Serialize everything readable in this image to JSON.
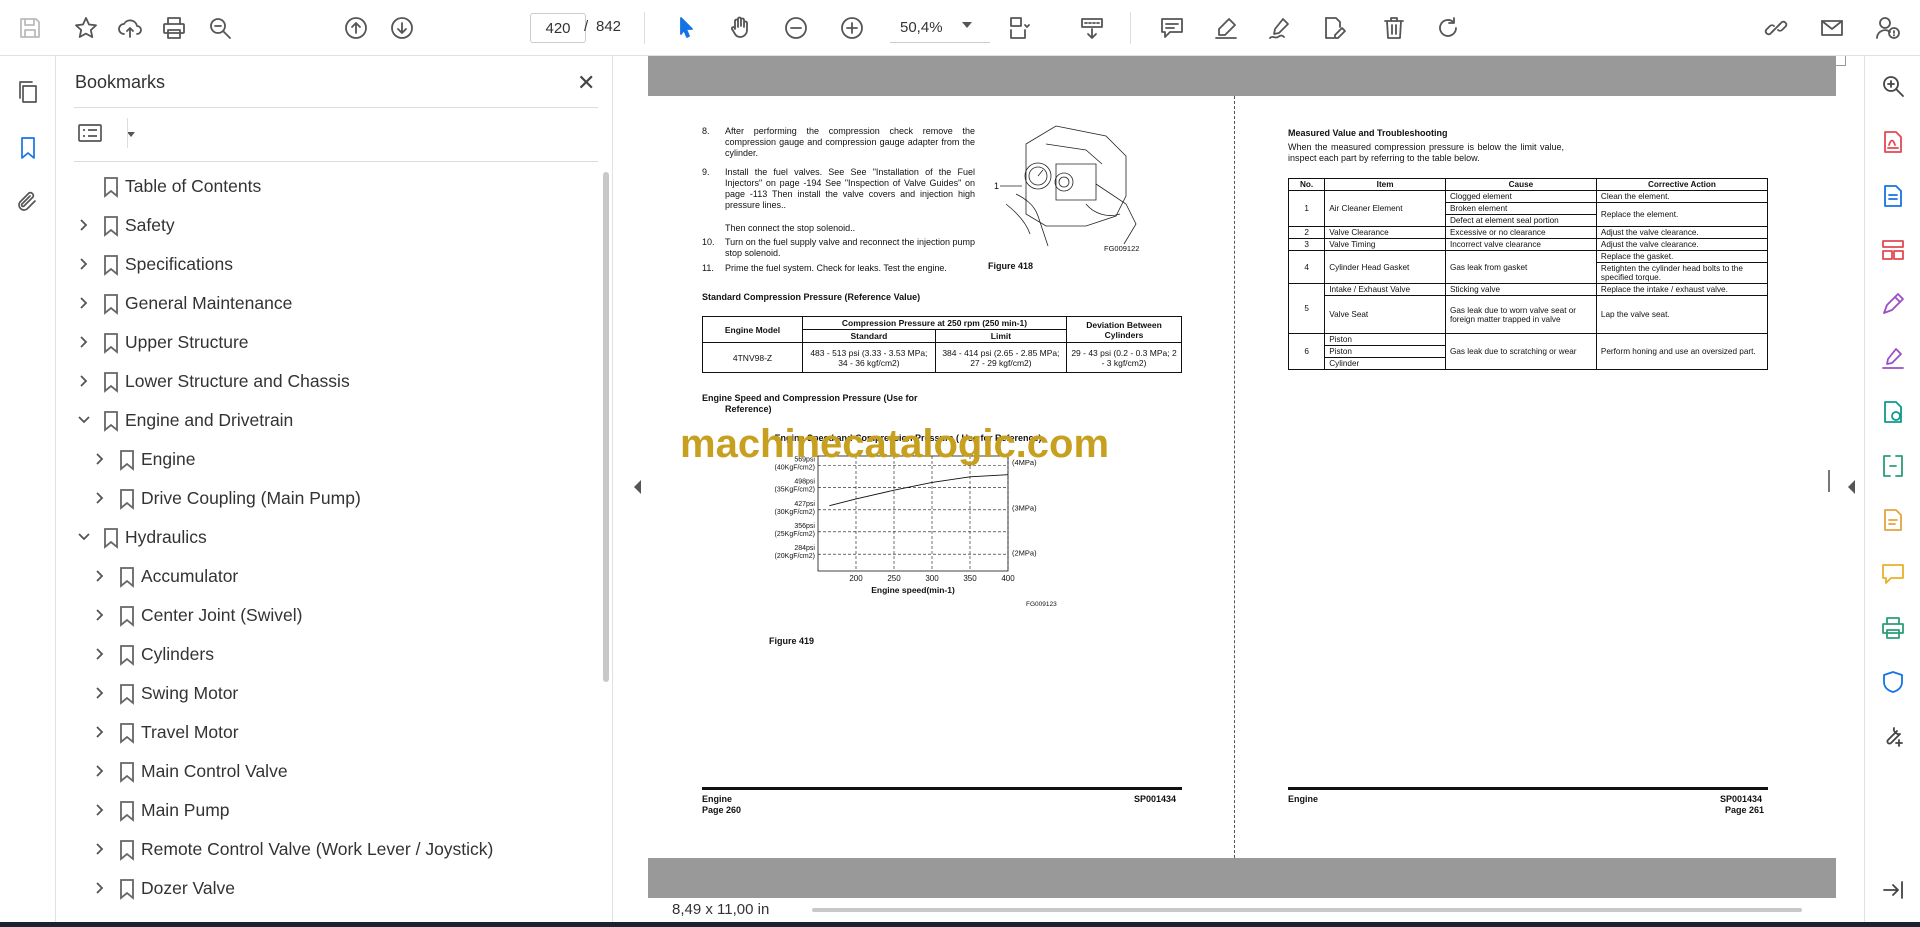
{
  "toolbar": {
    "page_current": "420",
    "page_sep": "/",
    "page_total": "842",
    "zoom": "50,4%"
  },
  "bookmarks": {
    "title": "Bookmarks",
    "close": "✕",
    "items": [
      {
        "label": "Table of Contents",
        "level": 0,
        "state": "none"
      },
      {
        "label": "Safety",
        "level": 0,
        "state": "collapsed"
      },
      {
        "label": "Specifications",
        "level": 0,
        "state": "collapsed"
      },
      {
        "label": "General Maintenance",
        "level": 0,
        "state": "collapsed"
      },
      {
        "label": "Upper Structure",
        "level": 0,
        "state": "collapsed"
      },
      {
        "label": "Lower Structure and Chassis",
        "level": 0,
        "state": "collapsed"
      },
      {
        "label": "Engine and Drivetrain",
        "level": 0,
        "state": "expanded"
      },
      {
        "label": "Engine",
        "level": 1,
        "state": "collapsed"
      },
      {
        "label": "Drive Coupling (Main Pump)",
        "level": 1,
        "state": "collapsed"
      },
      {
        "label": "Hydraulics",
        "level": 0,
        "state": "expanded"
      },
      {
        "label": "Accumulator",
        "level": 1,
        "state": "collapsed"
      },
      {
        "label": "Center Joint (Swivel)",
        "level": 1,
        "state": "collapsed"
      },
      {
        "label": "Cylinders",
        "level": 1,
        "state": "collapsed"
      },
      {
        "label": "Swing Motor",
        "level": 1,
        "state": "collapsed"
      },
      {
        "label": "Travel Motor",
        "level": 1,
        "state": "collapsed"
      },
      {
        "label": "Main Control Valve",
        "level": 1,
        "state": "collapsed"
      },
      {
        "label": "Main Pump",
        "level": 1,
        "state": "collapsed"
      },
      {
        "label": "Remote Control Valve (Work Lever / Joystick)",
        "level": 1,
        "state": "collapsed"
      },
      {
        "label": "Dozer Valve",
        "level": 1,
        "state": "collapsed"
      }
    ]
  },
  "status": {
    "page_size": "8,49 x 11,00 in"
  },
  "doc": {
    "watermark": "machinecatalogic.com",
    "left": {
      "steps": [
        {
          "n": "8.",
          "text": "After performing the compression check remove the compression gauge and compression gauge adapter from the cylinder."
        },
        {
          "n": "9.",
          "text": "Install the fuel valves. See See \"Installation of the Fuel Injectors\" on page -194 See \"Inspection of Valve Guides\" on page -113 Then install the valve covers and injection high pressure lines.."
        },
        {
          "n": "",
          "text": "Then connect the stop solenoid.."
        },
        {
          "n": "10.",
          "text": "Turn on the fuel supply valve and reconnect the injection pump stop solenoid."
        },
        {
          "n": "11.",
          "text": "Prime the fuel system. Check for leaks. Test the engine."
        }
      ],
      "figure418_label": "Figure 418",
      "figure418_callout": "1",
      "figure418_code": "FG009122",
      "std_heading": "Standard Compression Pressure (Reference Value)",
      "std_table": {
        "h_model": "Engine Model",
        "h_comp": "Compression Pressure at 250 rpm (250 min-1)",
        "h_std": "Standard",
        "h_limit": "Limit",
        "h_dev": "Deviation Between Cylinders",
        "model": "4TNV98-Z",
        "std": "483 - 513 psi (3.33 - 3.53 MPa; 34 - 36 kgf/cm2)",
        "limit": "384 - 414 psi (2.65 - 2.85 MPa; 27 - 29 kgf/cm2)",
        "dev": "29 - 43 psi (0.2 - 0.3 MPa; 2 - 3 kgf/cm2)"
      },
      "speed_heading_1": "Engine Speed and Compression Pressure (Use for",
      "speed_heading_2": "Reference)",
      "figure419_label": "Figure 419",
      "footer_section": "Engine",
      "footer_page": "Page 260",
      "footer_code": "SP001434"
    },
    "right": {
      "heading": "Measured Value and Troubleshooting",
      "intro": "When the measured compression pressure is below the limit value, inspect each part by referring to the table below.",
      "table_headers": [
        "No.",
        "Item",
        "Cause",
        "Corrective Action"
      ],
      "rows": [
        {
          "no": "1",
          "item": "Air Cleaner Element",
          "causes": [
            "Clogged element",
            "Broken element",
            "Defect at element seal portion"
          ],
          "actions": [
            "Clean the element.",
            "Replace the element."
          ]
        },
        {
          "no": "2",
          "item": "Valve Clearance",
          "causes": [
            "Excessive or no clearance"
          ],
          "actions": [
            "Adjust the valve clearance."
          ]
        },
        {
          "no": "3",
          "item": "Valve Timing",
          "causes": [
            "Incorrect valve clearance"
          ],
          "actions": [
            "Adjust the valve clearance."
          ]
        },
        {
          "no": "4",
          "item": "Cylinder Head Gasket",
          "causes": [
            "Gas leak from gasket"
          ],
          "actions": [
            "Replace the gasket.",
            "Retighten the cylinder head bolts to the specified torque."
          ]
        },
        {
          "no": "5",
          "item": "Intake / Exhaust Valve",
          "causes": [
            "Sticking valve"
          ],
          "actions": [
            "Replace the intake / exhaust valve."
          ]
        },
        {
          "no": "",
          "item": "Valve Seat",
          "causes": [
            "Gas leak due to worn valve seat or foreign matter trapped in valve"
          ],
          "actions": [
            "Lap the valve seat."
          ]
        },
        {
          "no": "6",
          "item": "Piston",
          "causes": [
            "Gas leak due to scratching or wear"
          ],
          "actions": [
            "Perform honing and use an oversized part."
          ]
        },
        {
          "no": "",
          "item": "Piston",
          "causes": [],
          "actions": []
        },
        {
          "no": "",
          "item": "Cylinder",
          "causes": [],
          "actions": []
        }
      ],
      "footer_section": "Engine",
      "footer_page": "Page 261",
      "footer_code": "SP001434"
    }
  },
  "chart_data": {
    "type": "line",
    "title": "Engine Speed and Compression Pressure ( Use for Reference)",
    "xlabel": "Engine speed(min-1)",
    "x_ticks": [
      "200",
      "250",
      "300",
      "350",
      "400"
    ],
    "y_ticks_left": [
      [
        "569psi",
        "(40KgF/cm2)"
      ],
      [
        "498psi",
        "(35KgF/cm2)"
      ],
      [
        "427psi",
        "(30KgF/cm2)"
      ],
      [
        "356psi",
        "(25KgF/cm2)"
      ],
      [
        "284psi",
        "(20KgF/cm2)"
      ]
    ],
    "y_ticks_right": [
      "(4MPa)",
      "(3MPa)",
      "(2MPa)"
    ],
    "xlim": [
      150,
      400
    ],
    "ylim_psi": [
      230,
      600
    ],
    "series": [
      {
        "x": [
          165,
          200,
          250,
          300,
          350,
          400
        ],
        "y": [
          440,
          462,
          490,
          515,
          533,
          540
        ]
      }
    ],
    "code": "FG009123"
  }
}
